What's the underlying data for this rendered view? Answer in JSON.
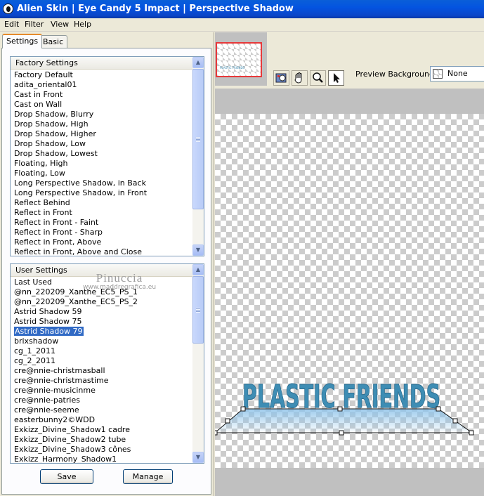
{
  "window": {
    "title": "Alien Skin | Eye Candy 5 Impact | Perspective Shadow"
  },
  "menu": [
    "Edit",
    "Filter",
    "View",
    "Help"
  ],
  "tabs": {
    "settings": "Settings",
    "basic": "Basic"
  },
  "factory": {
    "header": "Factory Settings",
    "items": [
      "Factory Default",
      "adita_oriental01",
      "Cast in Front",
      "Cast on Wall",
      "Drop Shadow, Blurry",
      "Drop Shadow, High",
      "Drop Shadow, Higher",
      "Drop Shadow, Low",
      "Drop Shadow, Lowest",
      "Floating, High",
      "Floating, Low",
      "Long Perspective Shadow, in Back",
      "Long Perspective Shadow, in Front",
      "Reflect Behind",
      "Reflect in Front",
      "Reflect in Front - Faint",
      "Reflect in Front - Sharp",
      "Reflect in Front, Above",
      "Reflect in Front, Above and Close"
    ]
  },
  "user": {
    "header": "User Settings",
    "selected": "Astrid Shadow 79",
    "items": [
      "Last Used",
      "@nn_220209_Xanthe_EC5_PS_1",
      "@nn_220209_Xanthe_EC5_PS_2",
      "Astrid Shadow 59",
      "Astrid Shadow 75",
      "Astrid Shadow 79",
      "brixshadow",
      "cg_1_2011",
      "cg_2_2011",
      "cre@nnie-christmasball",
      "cre@nnie-christmastime",
      "cre@nnie-musicinme",
      "cre@nnie-patries",
      "cre@nnie-seeme",
      "easterbunny2©WDD",
      "Exkizz_Divine_Shadow1 cadre",
      "Exkizz_Divine_Shadow2 tube",
      "Exkizz_Divine_Shadow3 cônes",
      "Exkizz_Harmony_Shadow1"
    ]
  },
  "buttons": {
    "save": "Save",
    "manage": "Manage"
  },
  "watermark": {
    "name": "Pinuccia",
    "url": "www.maddregrafica.eu"
  },
  "preview": {
    "background_label": "Preview Background:",
    "background_value": "None",
    "canvas_text": "PLASTIC FRIENDS",
    "text_color": "#3e8db4",
    "shadow_color": "#8fc4ea"
  },
  "icons": {
    "tool_1": "hand-zoom-icon",
    "tool_2": "hand-pan-icon",
    "tool_3": "magnifier-icon",
    "tool_4": "arrow-pointer-icon"
  }
}
